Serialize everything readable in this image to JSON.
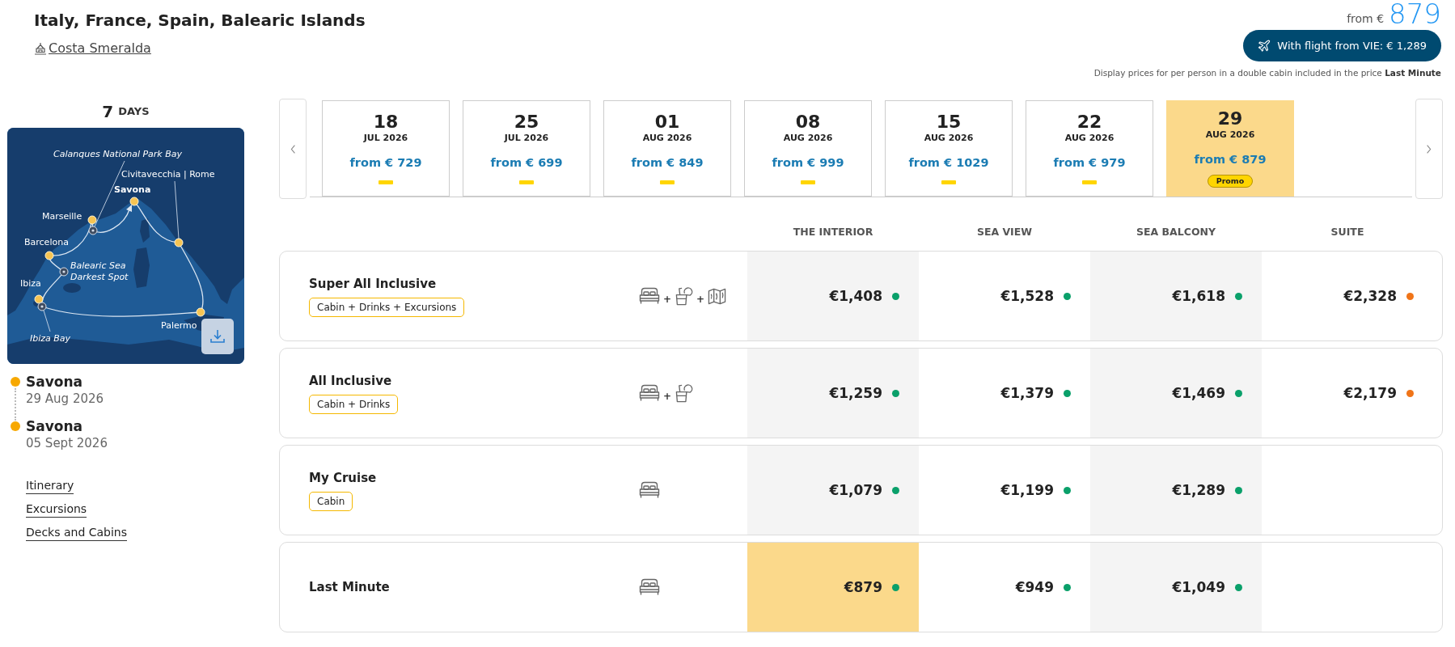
{
  "header": {
    "title": "Italy, France, Spain, Balearic Islands",
    "ship": "Costa Smeralda",
    "from_label": "from €",
    "from_price": "879",
    "flight_button": "With flight from VIE: € 1,289",
    "disclaimer": "Display prices for per person in a double cabin included in the price **Last Minute**"
  },
  "itinerary": {
    "duration_number": "7",
    "duration_unit": "DAYS",
    "map_stops": [
      {
        "name": "Calanques National Park Bay",
        "kind": "excursion"
      },
      {
        "name": "Civitavecchia | Rome",
        "kind": "port"
      },
      {
        "name": "Savona",
        "kind": "home"
      },
      {
        "name": "Marseille",
        "kind": "port"
      },
      {
        "name": "Barcelona",
        "kind": "port"
      },
      {
        "name": "Balearic Sea Darkest Spot",
        "kind": "excursion"
      },
      {
        "name": "Ibiza",
        "kind": "port"
      },
      {
        "name": "Palermo",
        "kind": "port"
      },
      {
        "name": "Ibiza Bay",
        "kind": "excursion"
      }
    ],
    "stops": [
      {
        "port": "Savona",
        "date": "29 Aug 2026"
      },
      {
        "port": "Savona",
        "date": "05 Sept 2026"
      }
    ],
    "links": [
      "Itinerary",
      "Excursions",
      "Decks and Cabins"
    ]
  },
  "dates": [
    {
      "day": "18",
      "month": "JUL 2026",
      "price": "from € 729",
      "selected": false
    },
    {
      "day": "25",
      "month": "JUL 2026",
      "price": "from € 699",
      "selected": false
    },
    {
      "day": "01",
      "month": "AUG 2026",
      "price": "from € 849",
      "selected": false
    },
    {
      "day": "08",
      "month": "AUG 2026",
      "price": "from € 999",
      "selected": false
    },
    {
      "day": "15",
      "month": "AUG 2026",
      "price": "from € 1029",
      "selected": false
    },
    {
      "day": "22",
      "month": "AUG 2026",
      "price": "from € 979",
      "selected": false
    },
    {
      "day": "29",
      "month": "AUG 2026",
      "price": "from € 879",
      "selected": true,
      "badge": "Promo"
    }
  ],
  "fares": {
    "columns": [
      "THE INTERIOR",
      "SEA VIEW",
      "SEA BALCONY",
      "SUITE"
    ],
    "rows": [
      {
        "name": "Super All Inclusive",
        "tag": "Cabin + Drinks + Excursions",
        "perks": [
          {
            "kind": "cabin"
          },
          {
            "kind": "drinks",
            "joiner": "+"
          },
          {
            "kind": "excursions",
            "joiner": "+"
          }
        ],
        "prices": [
          {
            "value": "€1,408",
            "color": "#0aa06a",
            "selected": false
          },
          {
            "value": "€1,528",
            "color": "#0aa06a",
            "selected": false
          },
          {
            "value": "€1,618",
            "color": "#0aa06a",
            "selected": false
          },
          {
            "value": "€2,328",
            "color": "#f07418",
            "selected": false
          }
        ]
      },
      {
        "name": "All Inclusive",
        "tag": "Cabin + Drinks",
        "perks": [
          {
            "kind": "cabin"
          },
          {
            "kind": "drinks",
            "joiner": "+"
          }
        ],
        "prices": [
          {
            "value": "€1,259",
            "color": "#0aa06a",
            "selected": false
          },
          {
            "value": "€1,379",
            "color": "#0aa06a",
            "selected": false
          },
          {
            "value": "€1,469",
            "color": "#0aa06a",
            "selected": false
          },
          {
            "value": "€2,179",
            "color": "#f07418",
            "selected": false
          }
        ]
      },
      {
        "name": "My Cruise",
        "tag": "Cabin",
        "perks": [
          {
            "kind": "cabin"
          }
        ],
        "prices": [
          {
            "value": "€1,079",
            "color": "#0aa06a",
            "selected": false
          },
          {
            "value": "€1,199",
            "color": "#0aa06a",
            "selected": false
          },
          {
            "value": "€1,289",
            "color": "#0aa06a",
            "selected": false
          }
        ]
      },
      {
        "name": "Last Minute",
        "perks": [
          {
            "kind": "cabin"
          }
        ],
        "prices": [
          {
            "value": "€879",
            "color": "#0aa06a",
            "selected": true
          },
          {
            "value": "€949",
            "color": "#0aa06a",
            "selected": false
          },
          {
            "value": "€1,049",
            "color": "#0aa06a",
            "selected": false
          }
        ]
      }
    ]
  }
}
